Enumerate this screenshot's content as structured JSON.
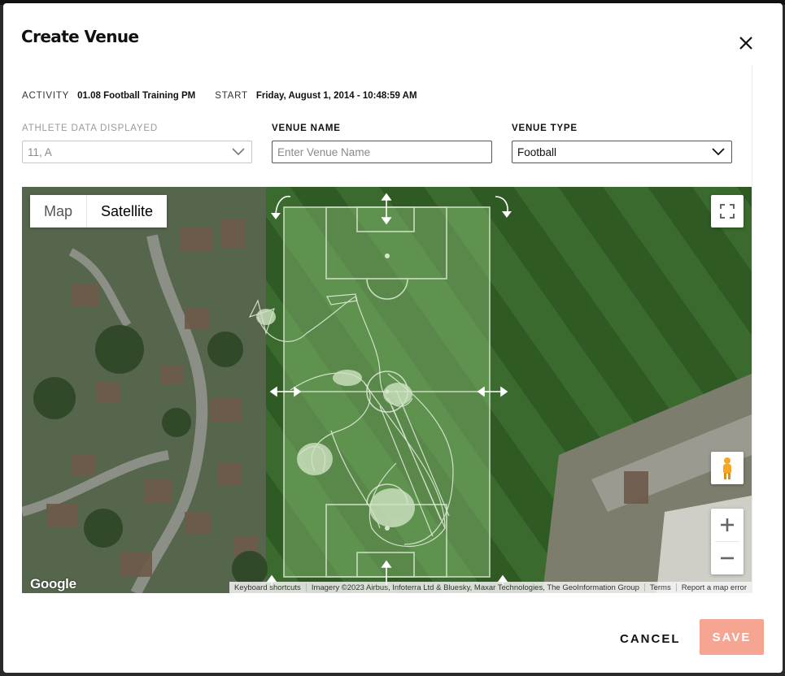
{
  "modal": {
    "title": "Create Venue"
  },
  "activity": {
    "label": "ACTIVITY",
    "value": "01.08 Football Training PM"
  },
  "start": {
    "label": "START",
    "value": "Friday, August 1, 2014 - 10:48:59 AM"
  },
  "athlete_data": {
    "label": "ATHLETE DATA DISPLAYED",
    "value": "11, A"
  },
  "venue_name": {
    "label": "VENUE NAME",
    "value": "",
    "placeholder": "Enter Venue Name"
  },
  "venue_type": {
    "label": "VENUE TYPE",
    "value": "Football"
  },
  "map": {
    "type_options": [
      "Map",
      "Satellite"
    ],
    "active_type": "Satellite",
    "logo": "Google",
    "attribution": {
      "shortcuts": "Keyboard shortcuts",
      "imagery": "Imagery ©2023 Airbus, Infoterra Ltd & Bluesky, Maxar Technologies, The GeoInformation Group",
      "terms": "Terms",
      "report": "Report a map error"
    },
    "icons": [
      "fullscreen-icon",
      "pegman-icon",
      "zoom-in-icon",
      "zoom-out-icon"
    ],
    "pitch_overlay_color": "#8fc07a"
  },
  "actions": {
    "cancel": "CANCEL",
    "save": "SAVE"
  },
  "colors": {
    "save_disabled": "#f6a593",
    "text": "#111111"
  }
}
